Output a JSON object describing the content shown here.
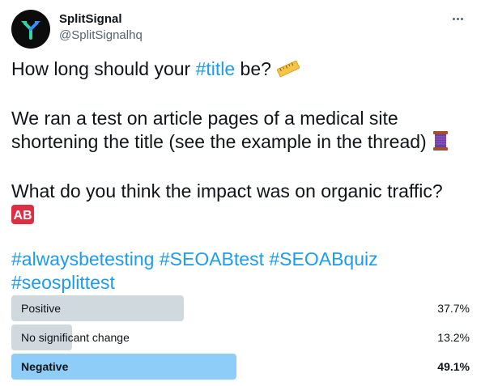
{
  "tweet": {
    "display_name": "SplitSignal",
    "handle": "@SplitSignalhq",
    "avatar_icon": "split-arrows-logo",
    "more_icon": "more-options-icon",
    "line1_before": "How long should your ",
    "line1_tag": "#title",
    "line1_after": " be? ",
    "line1_emoji": "straight-ruler",
    "para2_text": "We ran a test on article pages of a medical site shortening the title (see the example in the thread) ",
    "para2_emoji": "thread-spool",
    "para3_text": "What do you think the impact was on organic traffic?",
    "para3_emoji": "ab-button",
    "hashtags": [
      "#alwaysbetesting",
      "#SEOABtest",
      "#SEOABquiz",
      "#seosplittest"
    ]
  },
  "poll": {
    "choices": [
      {
        "label": "Positive",
        "percent_text": "37.7%",
        "percent": 37.7,
        "winner": false
      },
      {
        "label": "No significant change",
        "percent_text": "13.2%",
        "percent": 13.2,
        "winner": false
      },
      {
        "label": "Negative",
        "percent_text": "49.1%",
        "percent": 49.1,
        "winner": true
      }
    ]
  },
  "colors": {
    "link": "#1d9bf0",
    "bar": "#cfd9de",
    "bar_winner": "#8ecdf8",
    "text": "#0f1419",
    "muted": "#536471"
  }
}
